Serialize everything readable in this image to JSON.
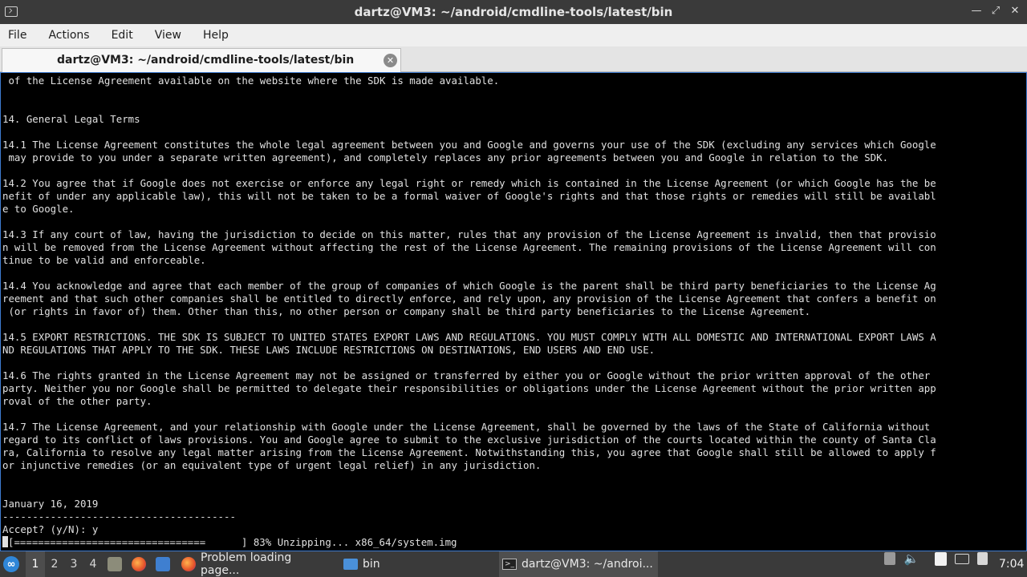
{
  "window": {
    "title": "dartz@VM3: ~/android/cmdline-tools/latest/bin",
    "controls": [
      "minimize",
      "maximize",
      "close"
    ]
  },
  "menu": [
    "File",
    "Actions",
    "Edit",
    "View",
    "Help"
  ],
  "tab": {
    "label": "dartz@VM3: ~/android/cmdline-tools/latest/bin"
  },
  "terminal": {
    "lines": [
      " of the License Agreement available on the website where the SDK is made available.",
      "",
      "",
      "14. General Legal Terms",
      "",
      "14.1 The License Agreement constitutes the whole legal agreement between you and Google and governs your use of the SDK (excluding any services which Google",
      " may provide to you under a separate written agreement), and completely replaces any prior agreements between you and Google in relation to the SDK.",
      "",
      "14.2 You agree that if Google does not exercise or enforce any legal right or remedy which is contained in the License Agreement (or which Google has the be",
      "nefit of under any applicable law), this will not be taken to be a formal waiver of Google's rights and that those rights or remedies will still be availabl",
      "e to Google.",
      "",
      "14.3 If any court of law, having the jurisdiction to decide on this matter, rules that any provision of the License Agreement is invalid, then that provisio",
      "n will be removed from the License Agreement without affecting the rest of the License Agreement. The remaining provisions of the License Agreement will con",
      "tinue to be valid and enforceable.",
      "",
      "14.4 You acknowledge and agree that each member of the group of companies of which Google is the parent shall be third party beneficiaries to the License Ag",
      "reement and that such other companies shall be entitled to directly enforce, and rely upon, any provision of the License Agreement that confers a benefit on",
      " (or rights in favor of) them. Other than this, no other person or company shall be third party beneficiaries to the License Agreement.",
      "",
      "14.5 EXPORT RESTRICTIONS. THE SDK IS SUBJECT TO UNITED STATES EXPORT LAWS AND REGULATIONS. YOU MUST COMPLY WITH ALL DOMESTIC AND INTERNATIONAL EXPORT LAWS A",
      "ND REGULATIONS THAT APPLY TO THE SDK. THESE LAWS INCLUDE RESTRICTIONS ON DESTINATIONS, END USERS AND END USE.",
      "",
      "14.6 The rights granted in the License Agreement may not be assigned or transferred by either you or Google without the prior written approval of the other",
      "party. Neither you nor Google shall be permitted to delegate their responsibilities or obligations under the License Agreement without the prior written app",
      "roval of the other party.",
      "",
      "14.7 The License Agreement, and your relationship with Google under the License Agreement, shall be governed by the laws of the State of California without",
      "regard to its conflict of laws provisions. You and Google agree to submit to the exclusive jurisdiction of the courts located within the county of Santa Cla",
      "ra, California to resolve any legal matter arising from the License Agreement. Notwithstanding this, you agree that Google shall still be allowed to apply f",
      "or injunctive remedies (or an equivalent type of urgent legal relief) in any jurisdiction.",
      "",
      "",
      "January 16, 2019",
      "---------------------------------------",
      "Accept? (y/N): y"
    ],
    "progress_line": "[================================      ] 83% Unzipping... x86_64/system.img",
    "progress_percent": 83
  },
  "taskbar": {
    "workspaces": [
      "1",
      "2",
      "3",
      "4"
    ],
    "active_workspace": "1",
    "tasks": [
      {
        "label": "Problem loading page...",
        "icon": "firefox-icon"
      },
      {
        "label": "bin",
        "icon": "folder-icon"
      },
      {
        "label": "dartz@VM3: ~/androi...",
        "icon": "terminal-icon"
      }
    ],
    "clock": "7:04"
  }
}
